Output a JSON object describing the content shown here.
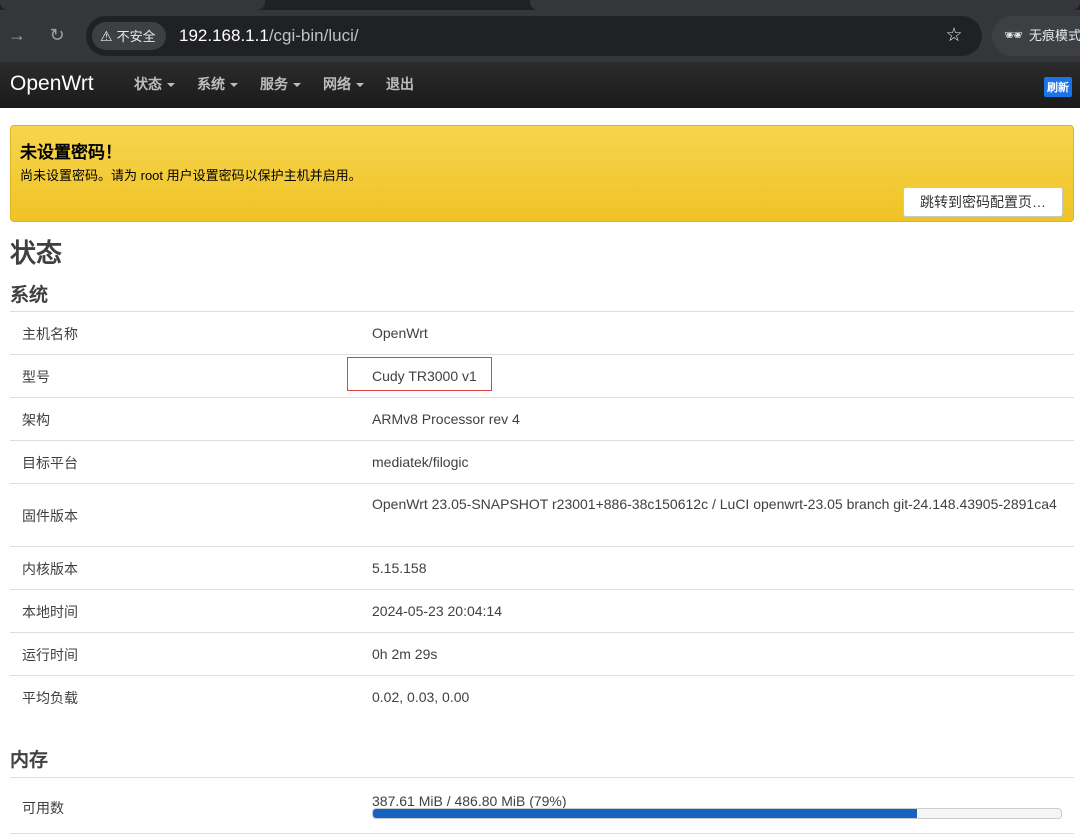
{
  "browser": {
    "security_label": "不安全",
    "url_host": "192.168.1.1",
    "url_path": "/cgi-bin/luci/",
    "incognito_label": "无痕模式"
  },
  "header": {
    "brand": "OpenWrt",
    "menu": [
      "状态",
      "系统",
      "服务",
      "网络",
      "退出"
    ],
    "refresh_label": "刷新"
  },
  "alert": {
    "title": "未设置密码！",
    "text": "尚未设置密码。请为 root 用户设置密码以保护主机并启用。",
    "button": "跳转到密码配置页…"
  },
  "page_title": "状态",
  "system": {
    "heading": "系统",
    "rows": [
      {
        "key": "主机名称",
        "value": "OpenWrt"
      },
      {
        "key": "型号",
        "value": "Cudy TR3000 v1"
      },
      {
        "key": "架构",
        "value": "ARMv8 Processor rev 4"
      },
      {
        "key": "目标平台",
        "value": "mediatek/filogic"
      },
      {
        "key": "固件版本",
        "value": "OpenWrt 23.05-SNAPSHOT r23001+886-38c150612c / LuCI openwrt-23.05 branch git-24.148.43905-2891ca4"
      },
      {
        "key": "内核版本",
        "value": "5.15.158"
      },
      {
        "key": "本地时间",
        "value": "2024-05-23 20:04:14"
      },
      {
        "key": "运行时间",
        "value": "0h 2m 29s"
      },
      {
        "key": "平均负载",
        "value": "0.02, 0.03, 0.00"
      }
    ]
  },
  "memory": {
    "heading": "内存",
    "rows": [
      {
        "key": "可用数",
        "value": "387.61 MiB / 486.80 MiB (79%)",
        "progress": 0.79
      }
    ]
  },
  "colors": {
    "alert_bg": "#f2c82d",
    "header_bg": "#222222",
    "progress_fill": "#1565c0",
    "highlight_border": "#e04040"
  }
}
